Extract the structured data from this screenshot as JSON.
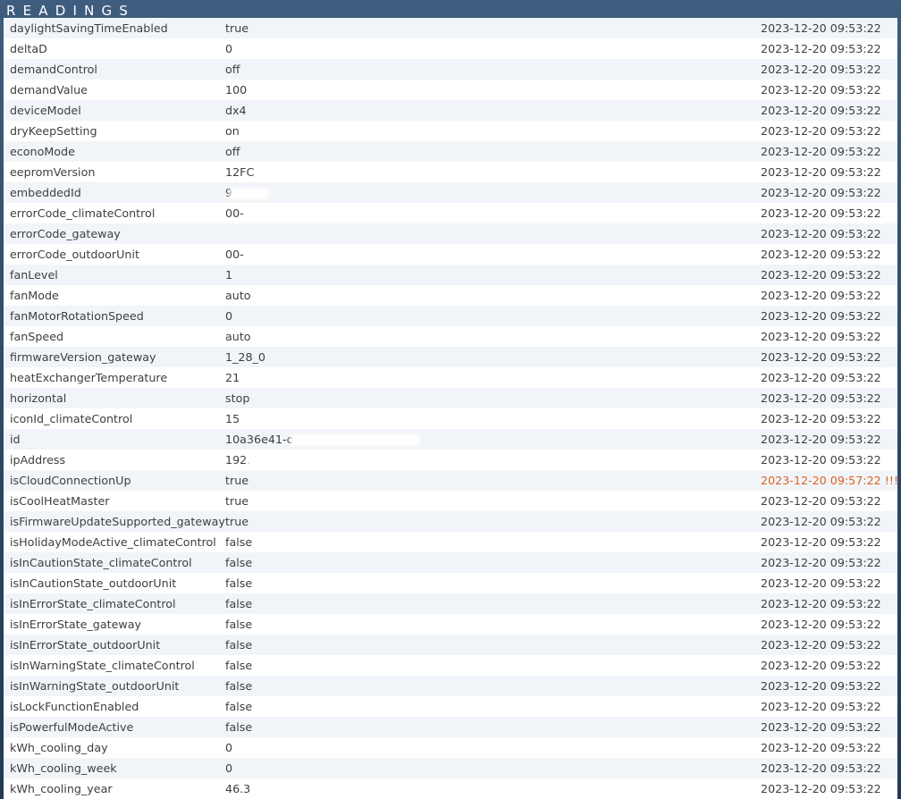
{
  "header": {
    "title": "Readings"
  },
  "readings": [
    {
      "name": "daylightSavingTimeEnabled",
      "value": "true",
      "time": "2023-12-20 09:53:22"
    },
    {
      "name": "deltaD",
      "value": "0",
      "time": "2023-12-20 09:53:22"
    },
    {
      "name": "demandControl",
      "value": "off",
      "time": "2023-12-20 09:53:22"
    },
    {
      "name": "demandValue",
      "value": "100",
      "time": "2023-12-20 09:53:22"
    },
    {
      "name": "deviceModel",
      "value": "dx4",
      "time": "2023-12-20 09:53:22"
    },
    {
      "name": "dryKeepSetting",
      "value": "on",
      "time": "2023-12-20 09:53:22"
    },
    {
      "name": "econoMode",
      "value": "off",
      "time": "2023-12-20 09:53:22"
    },
    {
      "name": "eepromVersion",
      "value": "12FC",
      "time": "2023-12-20 09:53:22"
    },
    {
      "name": "embeddedId",
      "value": "9",
      "time": "2023-12-20 09:53:22",
      "redacted": true
    },
    {
      "name": "errorCode_climateControl",
      "value": "00-",
      "time": "2023-12-20 09:53:22"
    },
    {
      "name": "errorCode_gateway",
      "value": "",
      "time": "2023-12-20 09:53:22"
    },
    {
      "name": "errorCode_outdoorUnit",
      "value": "00-",
      "time": "2023-12-20 09:53:22"
    },
    {
      "name": "fanLevel",
      "value": "1",
      "time": "2023-12-20 09:53:22"
    },
    {
      "name": "fanMode",
      "value": "auto",
      "time": "2023-12-20 09:53:22"
    },
    {
      "name": "fanMotorRotationSpeed",
      "value": "0",
      "time": "2023-12-20 09:53:22"
    },
    {
      "name": "fanSpeed",
      "value": "auto",
      "time": "2023-12-20 09:53:22"
    },
    {
      "name": "firmwareVersion_gateway",
      "value": "1_28_0",
      "time": "2023-12-20 09:53:22"
    },
    {
      "name": "heatExchangerTemperature",
      "value": "21",
      "time": "2023-12-20 09:53:22"
    },
    {
      "name": "horizontal",
      "value": "stop",
      "time": "2023-12-20 09:53:22"
    },
    {
      "name": "iconId_climateControl",
      "value": "15",
      "time": "2023-12-20 09:53:22"
    },
    {
      "name": "id",
      "value": "10a36e41-c",
      "time": "2023-12-20 09:53:22",
      "redacted": true
    },
    {
      "name": "ipAddress",
      "value": "192.",
      "time": "2023-12-20 09:53:22",
      "redacted": true
    },
    {
      "name": "isCloudConnectionUp",
      "value": "true",
      "time": "2023-12-20 09:57:22 !!!",
      "warning": true
    },
    {
      "name": "isCoolHeatMaster",
      "value": "true",
      "time": "2023-12-20 09:53:22"
    },
    {
      "name": "isFirmwareUpdateSupported_gateway",
      "value": "true",
      "time": "2023-12-20 09:53:22"
    },
    {
      "name": "isHolidayModeActive_climateControl",
      "value": "false",
      "time": "2023-12-20 09:53:22"
    },
    {
      "name": "isInCautionState_climateControl",
      "value": "false",
      "time": "2023-12-20 09:53:22"
    },
    {
      "name": "isInCautionState_outdoorUnit",
      "value": "false",
      "time": "2023-12-20 09:53:22"
    },
    {
      "name": "isInErrorState_climateControl",
      "value": "false",
      "time": "2023-12-20 09:53:22"
    },
    {
      "name": "isInErrorState_gateway",
      "value": "false",
      "time": "2023-12-20 09:53:22"
    },
    {
      "name": "isInErrorState_outdoorUnit",
      "value": "false",
      "time": "2023-12-20 09:53:22"
    },
    {
      "name": "isInWarningState_climateControl",
      "value": "false",
      "time": "2023-12-20 09:53:22"
    },
    {
      "name": "isInWarningState_outdoorUnit",
      "value": "false",
      "time": "2023-12-20 09:53:22"
    },
    {
      "name": "isLockFunctionEnabled",
      "value": "false",
      "time": "2023-12-20 09:53:22"
    },
    {
      "name": "isPowerfulModeActive",
      "value": "false",
      "time": "2023-12-20 09:53:22"
    },
    {
      "name": "kWh_cooling_day",
      "value": "0",
      "time": "2023-12-20 09:53:22"
    },
    {
      "name": "kWh_cooling_week",
      "value": "0",
      "time": "2023-12-20 09:53:22"
    },
    {
      "name": "kWh_cooling_year",
      "value": "46.3",
      "time": "2023-12-20 09:53:22"
    }
  ],
  "colors": {
    "header_background": "#2d4a69",
    "header_text": "#ffffff",
    "row_odd": "#f1f5f9",
    "row_even": "#ffffff",
    "text": "#3e3e3e",
    "warning_text": "#df5f1f"
  }
}
